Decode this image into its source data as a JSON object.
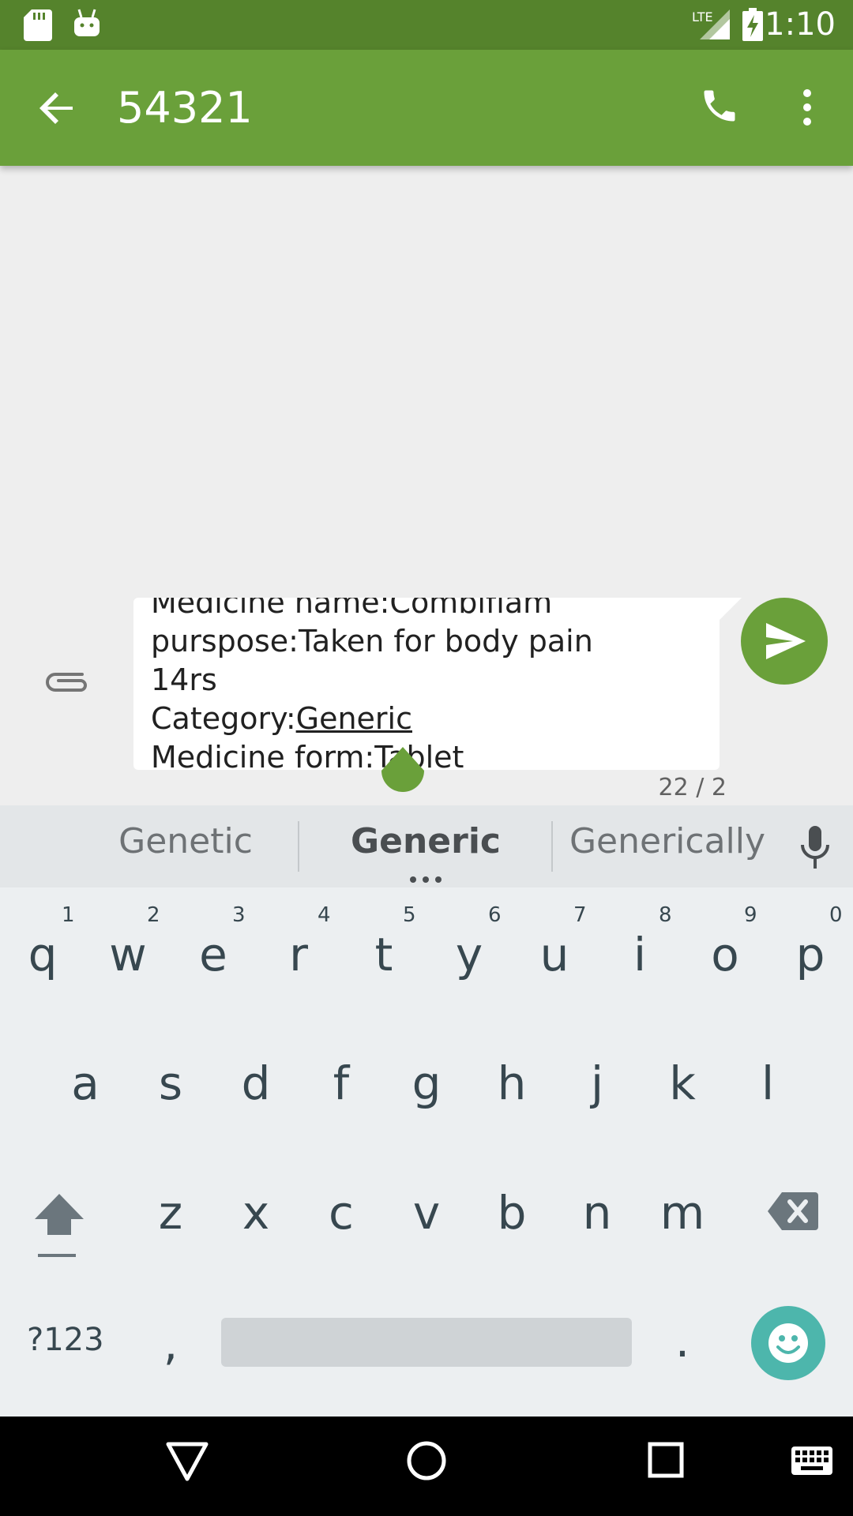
{
  "status_bar": {
    "time": "1:10",
    "network": "LTE",
    "icons": [
      "sd-card-icon",
      "android-icon",
      "signal-icon",
      "battery-charging-icon"
    ]
  },
  "app_bar": {
    "title": "54321",
    "icons": [
      "back-arrow-icon",
      "phone-icon",
      "more-vert-icon"
    ]
  },
  "compose": {
    "lines": [
      "Medicine name:Combiflam",
      "pursposе:Taken for body pain",
      "14rs",
      "Category:",
      "Medicine form:Tablet"
    ],
    "category_value": "Generic",
    "counter": "22 / 2"
  },
  "keyboard": {
    "suggestions": [
      "Genetic",
      "Generic",
      "Generically"
    ],
    "row1": [
      "q",
      "w",
      "e",
      "r",
      "t",
      "y",
      "u",
      "i",
      "o",
      "p"
    ],
    "row1_hints": [
      "1",
      "2",
      "3",
      "4",
      "5",
      "6",
      "7",
      "8",
      "9",
      "0"
    ],
    "row2": [
      "a",
      "s",
      "d",
      "f",
      "g",
      "h",
      "j",
      "k",
      "l"
    ],
    "row3": [
      "z",
      "x",
      "c",
      "v",
      "b",
      "n",
      "m"
    ],
    "symbols_key": "?123",
    "comma_key": ",",
    "period_key": "."
  },
  "colors": {
    "status_bar": "#55832c",
    "app_bar": "#6aa03a",
    "accent": "#6aa03a",
    "emoji_button": "#4db6ac"
  }
}
